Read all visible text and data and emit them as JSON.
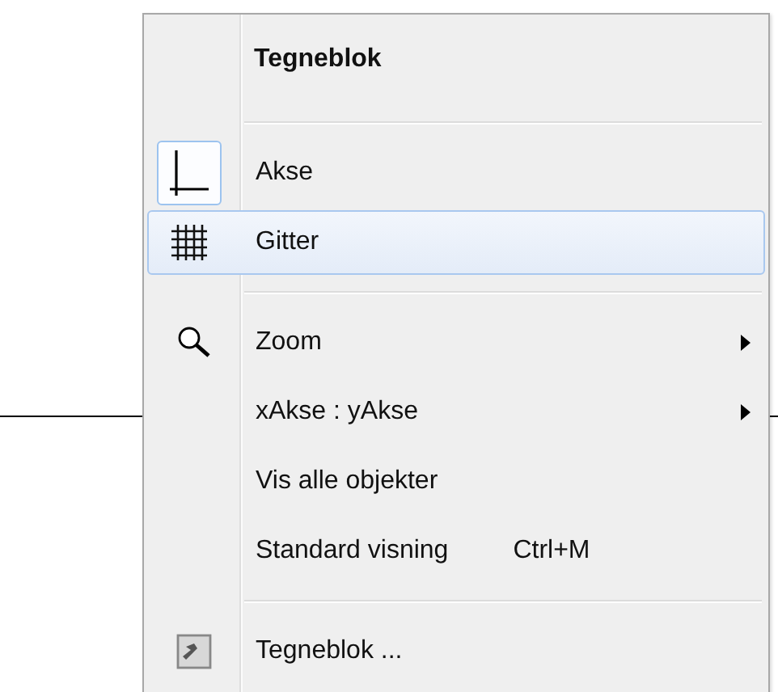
{
  "menu": {
    "title": "Tegneblok",
    "groups": [
      [
        {
          "kind": "toggle",
          "label": "Akse",
          "checked": true,
          "selected": false
        },
        {
          "kind": "toggle",
          "label": "Gitter",
          "checked": false,
          "selected": true
        }
      ],
      [
        {
          "kind": "submenu",
          "label": "Zoom",
          "selected": false
        },
        {
          "kind": "submenu",
          "label": "xAkse : yAkse",
          "selected": false
        },
        {
          "kind": "command",
          "label": "Vis alle objekter",
          "selected": false
        },
        {
          "kind": "command",
          "label": "Standard visning",
          "shortcut": "Ctrl+M",
          "selected": false
        }
      ],
      [
        {
          "kind": "command",
          "label": "Tegneblok ...",
          "selected": false
        }
      ]
    ]
  }
}
